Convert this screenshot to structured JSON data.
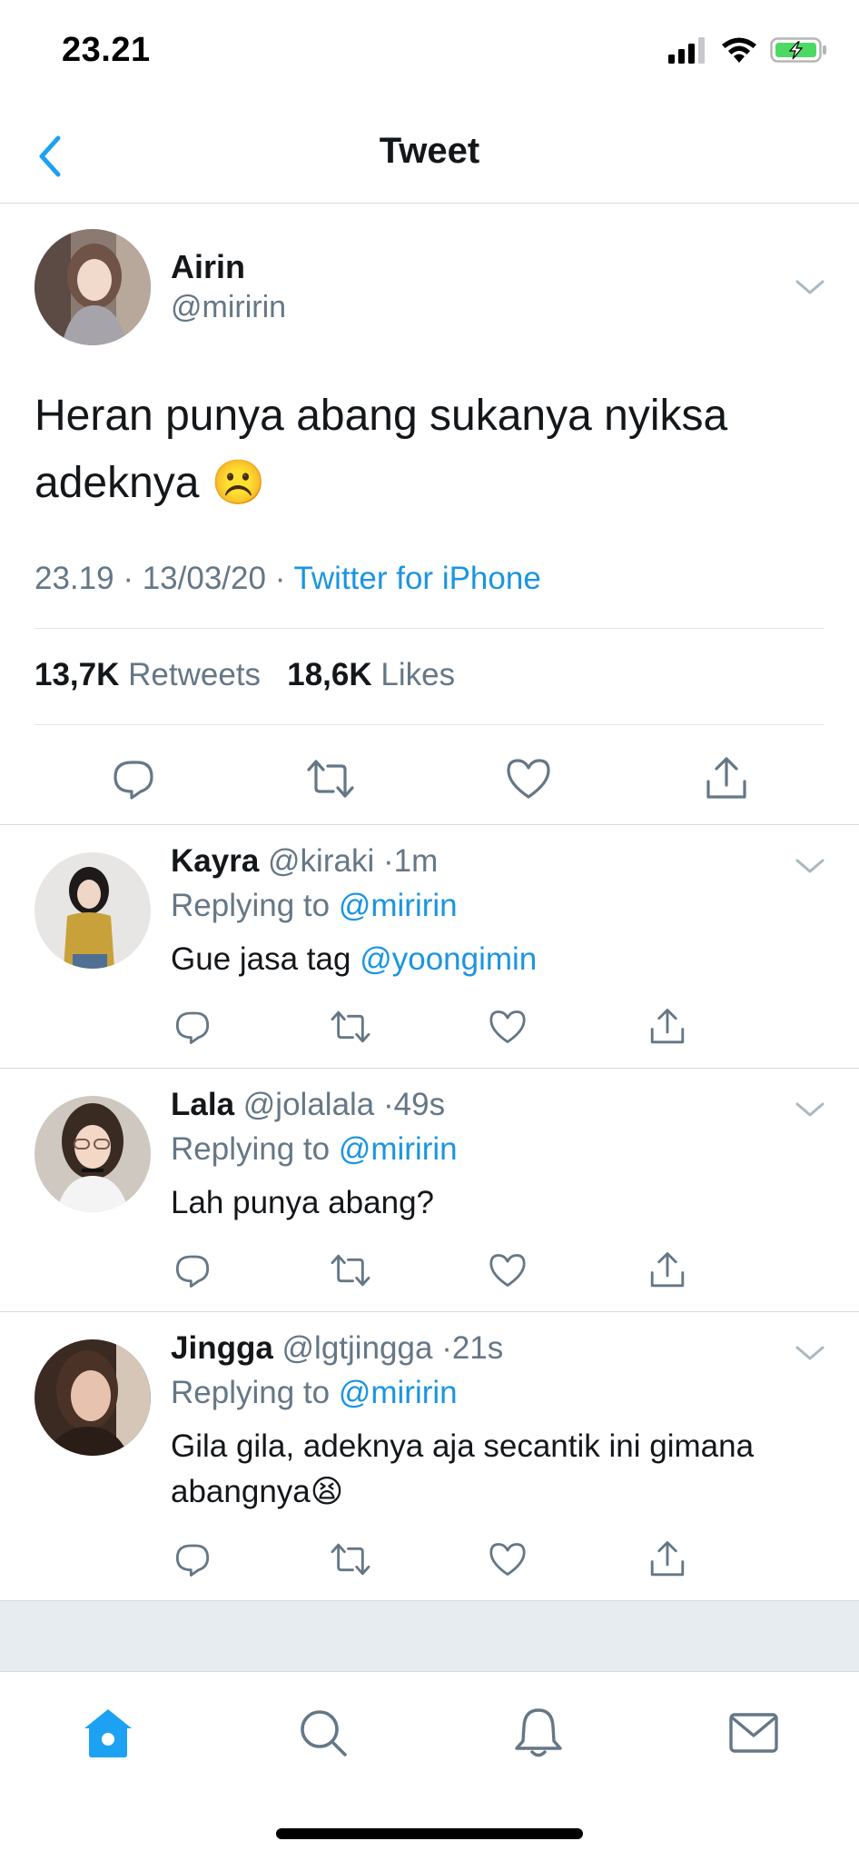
{
  "status_bar": {
    "time": "23.21"
  },
  "nav": {
    "title": "Tweet",
    "back_icon": "chevron-left-icon"
  },
  "main_tweet": {
    "name": "Airin",
    "handle": "@miririn",
    "text": "Heran punya abang sukanya nyiksa adeknya",
    "emoji": "☹️",
    "time": "23.19",
    "date": "13/03/20",
    "source": "Twitter for iPhone",
    "retweets_count": "13,7K",
    "retweets_label": "Retweets",
    "likes_count": "18,6K",
    "likes_label": "Likes"
  },
  "replies": [
    {
      "name": "Kayra",
      "handle": "@kiraki",
      "age": "1m",
      "replying_prefix": "Replying to",
      "replying_to": "@miririn",
      "text": "Gue jasa tag",
      "mention": "@yoongimin"
    },
    {
      "name": "Lala",
      "handle": "@jolalala",
      "age": "49s",
      "replying_prefix": "Replying to",
      "replying_to": "@miririn",
      "text": "Lah punya abang?"
    },
    {
      "name": "Jingga",
      "handle": "@lgtjingga",
      "age": "21s",
      "replying_prefix": "Replying to",
      "replying_to": "@miririn",
      "text": "Gila gila, adeknya aja secantik ini gimana abangnya",
      "emoji": "😫"
    }
  ],
  "tab_bar": {
    "items": [
      "home-icon",
      "search-icon",
      "bell-icon",
      "mail-icon"
    ],
    "active": "home-icon"
  },
  "colors": {
    "accent": "#1da1f2",
    "link": "#1b95e0",
    "text": "#14171a",
    "secondary_text": "#657786",
    "divider": "#e1e8ed"
  }
}
